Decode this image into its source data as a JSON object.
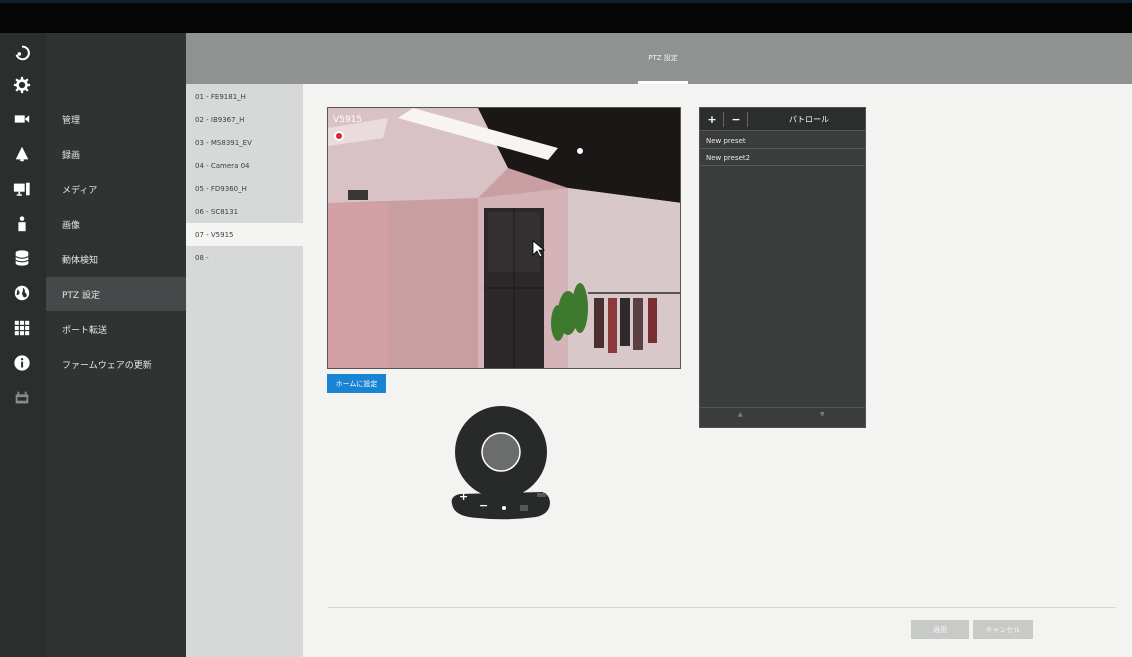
{
  "header": {
    "title": "PTZ 設定"
  },
  "menu": {
    "items": [
      {
        "label": "管理"
      },
      {
        "label": "録画"
      },
      {
        "label": "メディア"
      },
      {
        "label": "画像"
      },
      {
        "label": "動体検知"
      },
      {
        "label": "PTZ 設定",
        "active": true
      },
      {
        "label": "ポート転送"
      },
      {
        "label": "ファームウェアの更新"
      }
    ]
  },
  "iconbar": {
    "icons": [
      "swirl-icon",
      "gear-icon",
      "camera-icon",
      "bell-icon",
      "monitor-icon",
      "person-icon",
      "database-icon",
      "globe-icon",
      "grid-icon",
      "info-icon",
      "device-icon"
    ]
  },
  "cameras": [
    {
      "label": "01 - FE9181_H"
    },
    {
      "label": "02 - IB9367_H"
    },
    {
      "label": "03 - MS8391_EV"
    },
    {
      "label": "04 - Camera 04"
    },
    {
      "label": "05 - FD9360_H"
    },
    {
      "label": "06 - SC8131"
    },
    {
      "label": "07 - V5915",
      "active": true
    },
    {
      "label": "08 -"
    }
  ],
  "video": {
    "camera_name": "V5915"
  },
  "home_button": "ホームに設定",
  "patrol": {
    "add": "+",
    "remove": "−",
    "label": "パトロール",
    "presets": [
      "New preset",
      "New preset2"
    ],
    "up_arrow": "▲",
    "down_arrow": "▼"
  },
  "ptz": {
    "zoom_in": "+",
    "zoom_out": "−"
  },
  "footer": {
    "apply": "適用",
    "cancel": "キャンセル"
  },
  "colors": {
    "accent": "#1a84d4",
    "sidebar": "#2f3331",
    "iconbar": "#2a2e2d",
    "header": "#8f9290",
    "recording": "#d8282f"
  }
}
